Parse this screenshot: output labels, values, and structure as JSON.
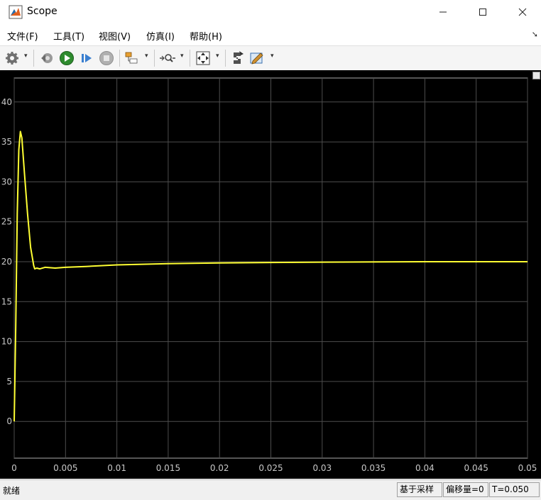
{
  "window": {
    "title": "Scope"
  },
  "menu": [
    "文件(F)",
    "工具(T)",
    "视图(V)",
    "仿真(I)",
    "帮助(H)"
  ],
  "toolbar": {
    "buttons": [
      "gear-icon",
      "step-back-icon",
      "run-icon",
      "step-forward-icon",
      "stop-icon",
      "signal-select-icon",
      "zoom-icon",
      "autoscale-icon",
      "highlight-icon",
      "style-icon"
    ]
  },
  "status": {
    "left": "就绪",
    "sample_based": "基于采样",
    "offset": "偏移量=0",
    "time": "T=0.050"
  },
  "colors": {
    "plot_bg": "#000000",
    "signal": "#ffff33",
    "grid": "#4d4d4d",
    "axis_text": "#c8c8c8"
  },
  "chart_data": {
    "type": "line",
    "xlim": [
      0,
      0.05
    ],
    "ylim": [
      -4.6,
      43
    ],
    "xticks": [
      "0",
      "0.005",
      "0.01",
      "0.015",
      "0.02",
      "0.025",
      "0.03",
      "0.035",
      "0.04",
      "0.045",
      "0.05"
    ],
    "yticks": [
      "0",
      "5",
      "10",
      "15",
      "20",
      "25",
      "30",
      "35",
      "40"
    ],
    "grid": true,
    "series": [
      {
        "color": "#ffff33",
        "x": [
          0,
          0.00015,
          0.0003,
          0.00045,
          0.0006,
          0.00075,
          0.001,
          0.0013,
          0.0016,
          0.0019,
          0.002,
          0.0022,
          0.0025,
          0.003,
          0.004,
          0.005,
          0.007,
          0.01,
          0.015,
          0.02,
          0.03,
          0.04,
          0.05
        ],
        "y": [
          0,
          12,
          26,
          34,
          36.3,
          35.5,
          31,
          26,
          21.8,
          19.5,
          19.1,
          19.2,
          19.1,
          19.3,
          19.2,
          19.3,
          19.4,
          19.6,
          19.75,
          19.85,
          19.95,
          20.0,
          20.0
        ]
      }
    ]
  }
}
